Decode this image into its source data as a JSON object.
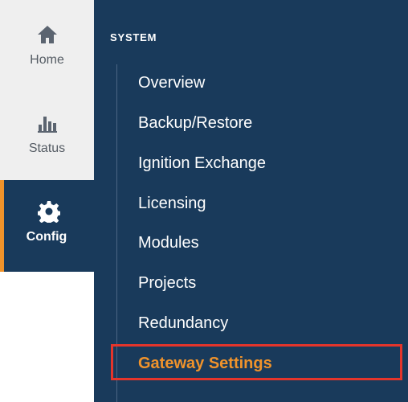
{
  "rail": {
    "items": [
      {
        "label": "Home",
        "icon": "home-icon"
      },
      {
        "label": "Status",
        "icon": "bar-chart-icon"
      },
      {
        "label": "Config",
        "icon": "gear-icon"
      }
    ],
    "active_accent": "#f0932b"
  },
  "panel": {
    "section_title": "SYSTEM",
    "items": [
      {
        "label": "Overview"
      },
      {
        "label": "Backup/Restore"
      },
      {
        "label": "Ignition Exchange"
      },
      {
        "label": "Licensing"
      },
      {
        "label": "Modules"
      },
      {
        "label": "Projects"
      },
      {
        "label": "Redundancy"
      },
      {
        "label": "Gateway Settings",
        "selected": true
      }
    ]
  },
  "colors": {
    "panel_bg": "#193a5b",
    "active_text": "#f0932b",
    "highlight_border": "#e4352b"
  }
}
